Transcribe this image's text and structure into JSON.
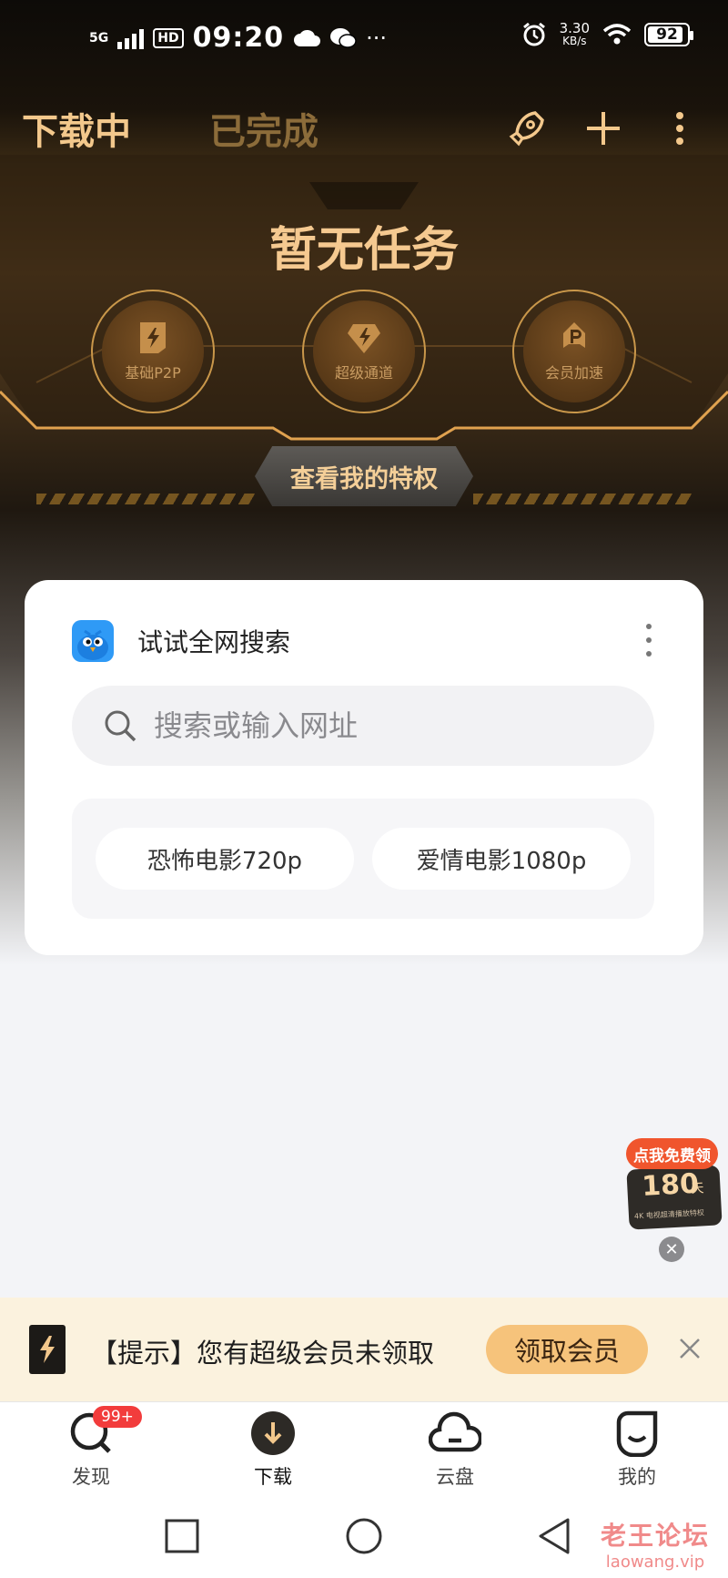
{
  "status_bar": {
    "network": "5G",
    "hd": "HD",
    "time": "09:20",
    "more": "···",
    "speed_value": "3.30",
    "speed_unit": "KB/s",
    "battery": "92"
  },
  "header": {
    "tabs": [
      {
        "label": "下载中",
        "active": true
      },
      {
        "label": "已完成",
        "active": false
      }
    ]
  },
  "hero": {
    "empty_title": "暂无任务",
    "perks": [
      {
        "label": "基础P2P",
        "icon": "bolt-icon"
      },
      {
        "label": "超级通道",
        "icon": "diamond-bolt-icon"
      },
      {
        "label": "会员加速",
        "icon": "rocket-p-icon"
      }
    ],
    "privilege_button": "查看我的特权"
  },
  "search_card": {
    "title": "试试全网搜索",
    "search_placeholder": "搜索或输入网址",
    "suggestions": [
      "恐怖电影720p",
      "爱情电影1080p"
    ]
  },
  "promo": {
    "tag": "点我免费领",
    "days": "180",
    "unit": "天",
    "sub": "4K 电视超清播放特权"
  },
  "notice": {
    "text": "【提示】您有超级会员未领取",
    "button": "领取会员"
  },
  "bottom_nav": {
    "items": [
      {
        "label": "发现",
        "icon": "discover-icon",
        "badge": "99+"
      },
      {
        "label": "下载",
        "icon": "download-icon",
        "active": true
      },
      {
        "label": "云盘",
        "icon": "cloud-icon"
      },
      {
        "label": "我的",
        "icon": "profile-icon"
      }
    ]
  },
  "watermark": {
    "line1": "老王论坛",
    "line2": "laowang.vip"
  },
  "colors": {
    "accent_gold": "#f3c88c",
    "notice_bg": "#fbf2de",
    "badge_red": "#f23c3c"
  }
}
